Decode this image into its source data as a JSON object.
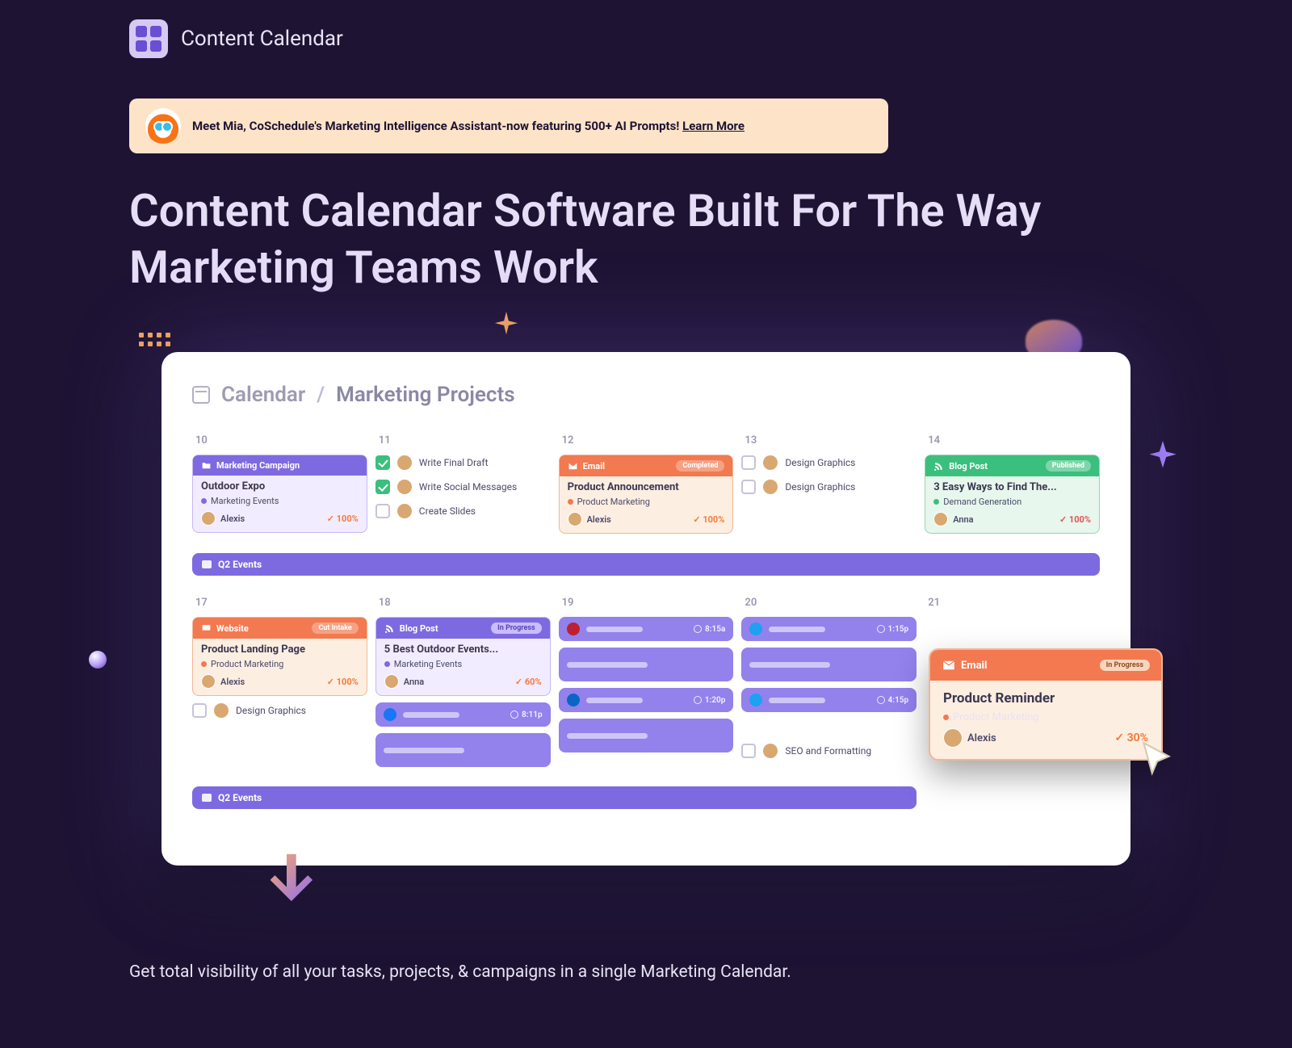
{
  "header": {
    "title": "Content Calendar"
  },
  "banner": {
    "text": "Meet Mia, CoSchedule's Marketing Intelligence Assistant-now featuring 500+ AI Prompts! ",
    "link": "Learn More"
  },
  "hero": "Content Calendar Software Built For The Way Marketing Teams Work",
  "breadcrumb": {
    "root": "Calendar",
    "sep": "/",
    "current": "Marketing Projects"
  },
  "days": [
    10,
    11,
    12,
    13,
    14,
    17,
    18,
    19,
    20,
    21
  ],
  "lane": "Q2 Events",
  "cards": {
    "c10": {
      "head": "Marketing Campaign",
      "title": "Outdoor Expo",
      "sub": "Marketing Events",
      "dot": "#7e6ae0",
      "user": "Alexis",
      "pct": "100%"
    },
    "c12": {
      "head": "Email",
      "title": "Product Announcement",
      "sub": "Product Marketing",
      "dot": "#f27950",
      "user": "Alexis",
      "pct": "100%"
    },
    "c14": {
      "head": "Blog Post",
      "title": "3 Easy Ways to Find The...",
      "sub": "Demand Generation",
      "dot": "#3bbf7d",
      "user": "Anna",
      "pct": "100%"
    },
    "c17": {
      "head": "Website",
      "title": "Product Landing Page",
      "sub": "Product Marketing",
      "dot": "#f27950",
      "user": "Alexis",
      "pct": "100%"
    },
    "c18": {
      "head": "Blog Post",
      "title": "5 Best Outdoor Events...",
      "sub": "Marketing Events",
      "dot": "#7e6ae0",
      "user": "Anna",
      "pct": "60%"
    }
  },
  "tasks": {
    "d11": [
      {
        "label": "Write Final Draft",
        "checked": true
      },
      {
        "label": "Write Social Messages",
        "checked": true
      },
      {
        "label": "Create Slides",
        "checked": false
      }
    ],
    "d13": [
      {
        "label": "Design Graphics",
        "checked": false
      },
      {
        "label": "Design Graphics",
        "checked": false
      }
    ],
    "d17_extra": {
      "label": "Design Graphics",
      "checked": false
    },
    "d20_extra": {
      "label": "SEO and Formatting",
      "checked": false
    }
  },
  "social": {
    "d18_fb_time": "8:11p",
    "d19": [
      {
        "net": "pin",
        "time": "8:15a"
      },
      {
        "net": "li",
        "time": "1:20p"
      }
    ],
    "d20": [
      {
        "net": "tw",
        "time": "1:15p"
      },
      {
        "net": "tw",
        "time": "4:15p"
      }
    ]
  },
  "pills": {
    "in_progress": "In Progress"
  },
  "float": {
    "head": "Email",
    "status": "In Progress",
    "title": "Product Reminder",
    "sub": "Product Marketing",
    "dot": "#f27950",
    "user": "Alexis",
    "pct": "30%"
  },
  "tagline": "Get total visibility of all your tasks, projects, & campaigns in a single Marketing Calendar."
}
